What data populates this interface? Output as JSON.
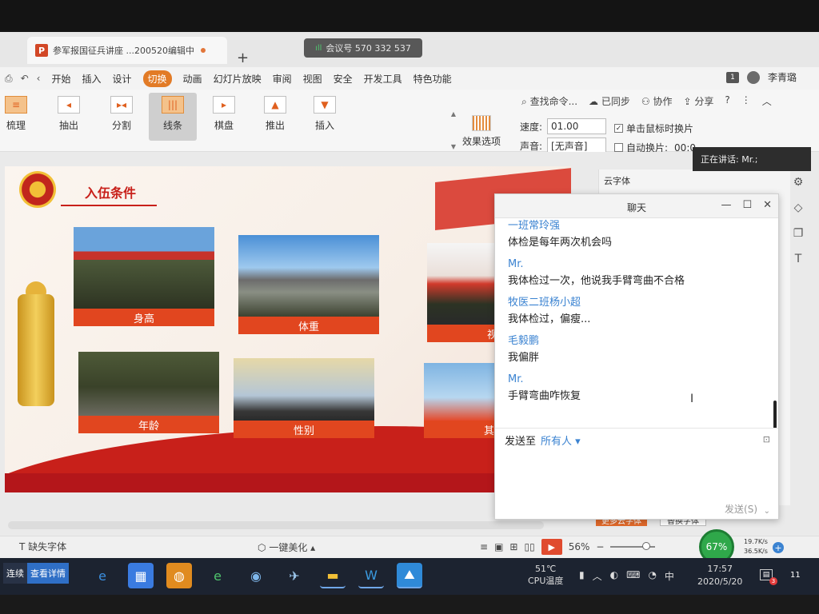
{
  "tab": {
    "logo": "P",
    "title": "参军报国征兵讲座 ...200520编辑中",
    "new_tab": "+"
  },
  "meeting": {
    "label": "会议号 570 332 537"
  },
  "menu": {
    "items": [
      "开始",
      "插入",
      "设计",
      "切换",
      "动画",
      "幻灯片放映",
      "审阅",
      "视图",
      "安全",
      "开发工具",
      "特色功能"
    ],
    "active": "切换",
    "search": "查找命令...",
    "synced": "已同步",
    "collab": "协作",
    "share": "分享",
    "user": "李青璐",
    "badge": "1"
  },
  "ribbon": {
    "buttons": [
      "梳理",
      "抽出",
      "分割",
      "线条",
      "棋盘",
      "推出",
      "插入"
    ],
    "selected": "线条",
    "effect_options": "效果选项",
    "speed_label": "速度:",
    "speed_value": "01.00",
    "sound_label": "声音:",
    "sound_value": "[无声音]",
    "click_switch": "单击鼠标时换片",
    "auto_switch": "自动换片:",
    "auto_value": "00:0"
  },
  "speaking": "正在讲话: Mr.;",
  "slide": {
    "title": "入伍条件",
    "cards": [
      "身高",
      "体重",
      "视力",
      "年龄",
      "性别",
      "其他"
    ]
  },
  "side_panel": {
    "cloud_font": "云字体",
    "btn_a": "更多云字体",
    "btn_b": "替换字体"
  },
  "chat": {
    "title": "聊天",
    "messages": [
      {
        "sender": "一班常玲强",
        "text": "体检是每年两次机会吗"
      },
      {
        "sender": "Mr.",
        "text": "我体检过一次，他说我手臂弯曲不合格"
      },
      {
        "sender": "牧医二班杨小超",
        "text": "我体检过，偏瘦..."
      },
      {
        "sender": "毛毅鹏",
        "text": "我偏胖"
      },
      {
        "sender": "Mr.",
        "text": "手臂弯曲咋恢复"
      }
    ],
    "send_to_label": "发送至",
    "send_to_value": "所有人",
    "send_button": "发送(S)"
  },
  "status": {
    "missing_font": "缺失字体",
    "beautify": "一键美化",
    "zoom": "56%",
    "gauge": "67%",
    "up_speed": "19.7K/s",
    "down_speed": "36.5K/s"
  },
  "taskbar": {
    "toast_left": "连续",
    "toast_right": "查看详情",
    "temp": "51℃",
    "temp_label": "CPU温度",
    "ime": "中",
    "time": "17:57",
    "date": "2020/5/20",
    "notif_count": "11",
    "notif_badge": "3"
  },
  "colors": {
    "accent": "#e27b26",
    "slide_red": "#c8201a",
    "chat_name": "#3b83d1"
  }
}
